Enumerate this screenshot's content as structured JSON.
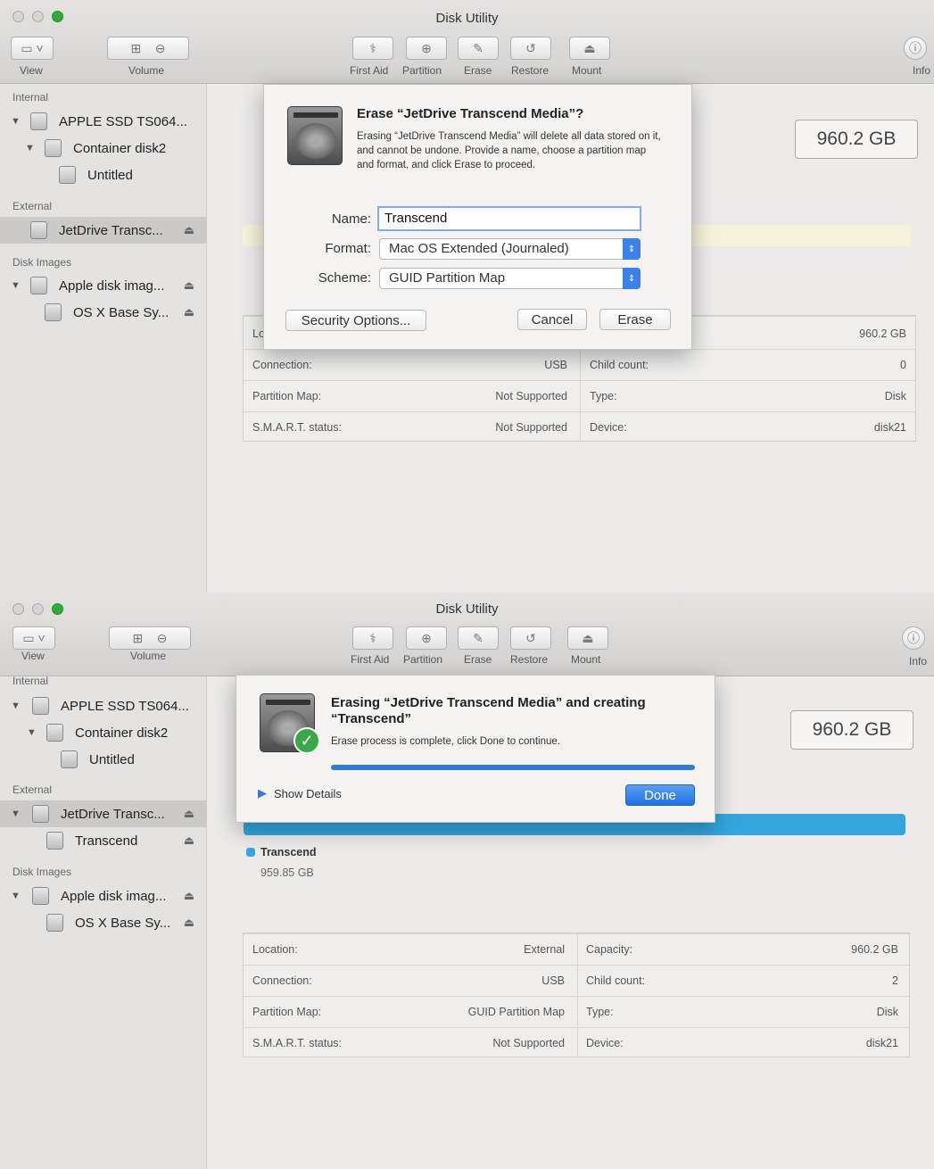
{
  "window_title": "Disk Utility",
  "toolbar": {
    "view_label": "View",
    "volume_label": "Volume",
    "first_aid_label": "First Aid",
    "partition_label": "Partition",
    "erase_label": "Erase",
    "restore_label": "Restore",
    "mount_label": "Mount",
    "info_label": "Info"
  },
  "icons": {
    "first_aid": "stethoscope-icon",
    "partition": "partition-icon",
    "erase": "erase-icon",
    "restore": "restore-icon",
    "mount": "mount-icon",
    "info": "info-icon",
    "eject": "eject-icon"
  },
  "colors": {
    "accent_blue": "#2d7bdb",
    "volume_blue": "#35a6dd",
    "check_green": "#3aa84a",
    "traffic_green": "#32a93a"
  },
  "screen1": {
    "sidebar": {
      "internal_header": "Internal",
      "external_header": "External",
      "disk_images_header": "Disk Images",
      "items": [
        {
          "label": "APPLE SSD TS064..."
        },
        {
          "label": "Container disk2"
        },
        {
          "label": "Untitled"
        },
        {
          "label": "JetDrive Transc..."
        },
        {
          "label": "Apple disk imag..."
        },
        {
          "label": "OS X Base Sy..."
        }
      ]
    },
    "capacity": "960.2 GB",
    "info_table": {
      "location_label_partial": "Lo",
      "capacity_value": "960.2 GB",
      "rows": [
        {
          "label": "Connection:",
          "value": "USB",
          "label2": "Child count:",
          "value2": "0"
        },
        {
          "label": "Partition Map:",
          "value": "Not Supported",
          "label2": "Type:",
          "value2": "Disk"
        },
        {
          "label": "S.M.A.R.T. status:",
          "value": "Not Supported",
          "label2": "Device:",
          "value2": "disk21"
        }
      ]
    },
    "dialog": {
      "title": "Erase “JetDrive Transcend Media”?",
      "message": "Erasing “JetDrive Transcend Media” will delete all data stored on it, and cannot be undone. Provide a name, choose a partition map and format, and click Erase to proceed.",
      "name_label": "Name:",
      "name_value": "Transcend",
      "format_label": "Format:",
      "format_value": "Mac OS Extended (Journaled)",
      "scheme_label": "Scheme:",
      "scheme_value": "GUID Partition Map",
      "security_button": "Security Options...",
      "cancel_button": "Cancel",
      "erase_button": "Erase"
    }
  },
  "screen2": {
    "sidebar": {
      "internal_header": "Internal",
      "external_header": "External",
      "disk_images_header": "Disk Images",
      "items": [
        {
          "label": "APPLE SSD TS064..."
        },
        {
          "label": "Container disk2"
        },
        {
          "label": "Untitled"
        },
        {
          "label": "JetDrive Transc..."
        },
        {
          "label": "Transcend"
        },
        {
          "label": "Apple disk imag..."
        },
        {
          "label": "OS X Base Sy..."
        }
      ]
    },
    "capacity": "960.2 GB",
    "volume_legend": {
      "name": "Transcend",
      "size": "959.85 GB"
    },
    "info_table": {
      "rows": [
        {
          "label": "Location:",
          "value": "External",
          "label2": "Capacity:",
          "value2": "960.2 GB"
        },
        {
          "label": "Connection:",
          "value": "USB",
          "label2": "Child count:",
          "value2": "2"
        },
        {
          "label": "Partition Map:",
          "value": "GUID Partition Map",
          "label2": "Type:",
          "value2": "Disk"
        },
        {
          "label": "S.M.A.R.T. status:",
          "value": "Not Supported",
          "label2": "Device:",
          "value2": "disk21"
        }
      ]
    },
    "dialog": {
      "title_line1": "Erasing “JetDrive Transcend Media” and creating",
      "title_line2": "“Transcend”",
      "message": "Erase process is complete, click Done to continue.",
      "progress": 1.0,
      "show_details": "Show Details",
      "done_button": "Done"
    }
  }
}
